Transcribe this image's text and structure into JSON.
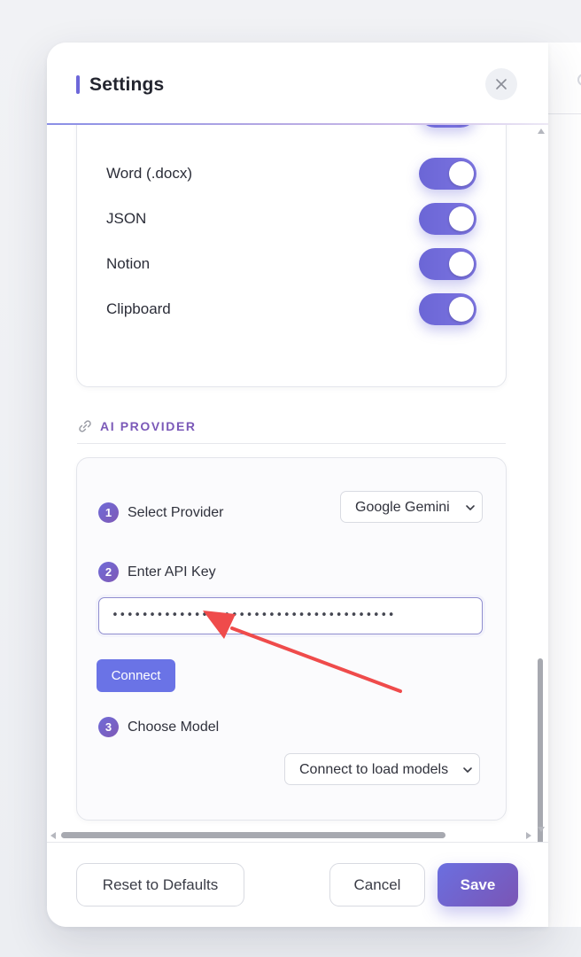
{
  "header": {
    "title": "Settings",
    "close_icon": "close-icon"
  },
  "export_options": [
    {
      "label": "Word (.docx)",
      "enabled": true
    },
    {
      "label": "JSON",
      "enabled": true
    },
    {
      "label": "Notion",
      "enabled": true
    },
    {
      "label": "Clipboard",
      "enabled": true
    }
  ],
  "ai_provider": {
    "section_title": "AI PROVIDER",
    "section_icon": "link-icon",
    "steps": [
      {
        "number": "1",
        "label": "Select Provider"
      },
      {
        "number": "2",
        "label": "Enter API Key"
      },
      {
        "number": "3",
        "label": "Choose Model"
      }
    ],
    "provider_select": {
      "value": "Google Gemini"
    },
    "api_key": {
      "value": "••••••••••••••••••••••••••••••••••••••"
    },
    "connect_label": "Connect",
    "model_select": {
      "value": "Connect to load models"
    }
  },
  "footer": {
    "reset_label": "Reset to Defaults",
    "cancel_label": "Cancel",
    "save_label": "Save"
  },
  "colors": {
    "accent": "#6b66d6",
    "section_title": "#7b59b8",
    "annotation_arrow": "#ef4b4b"
  }
}
